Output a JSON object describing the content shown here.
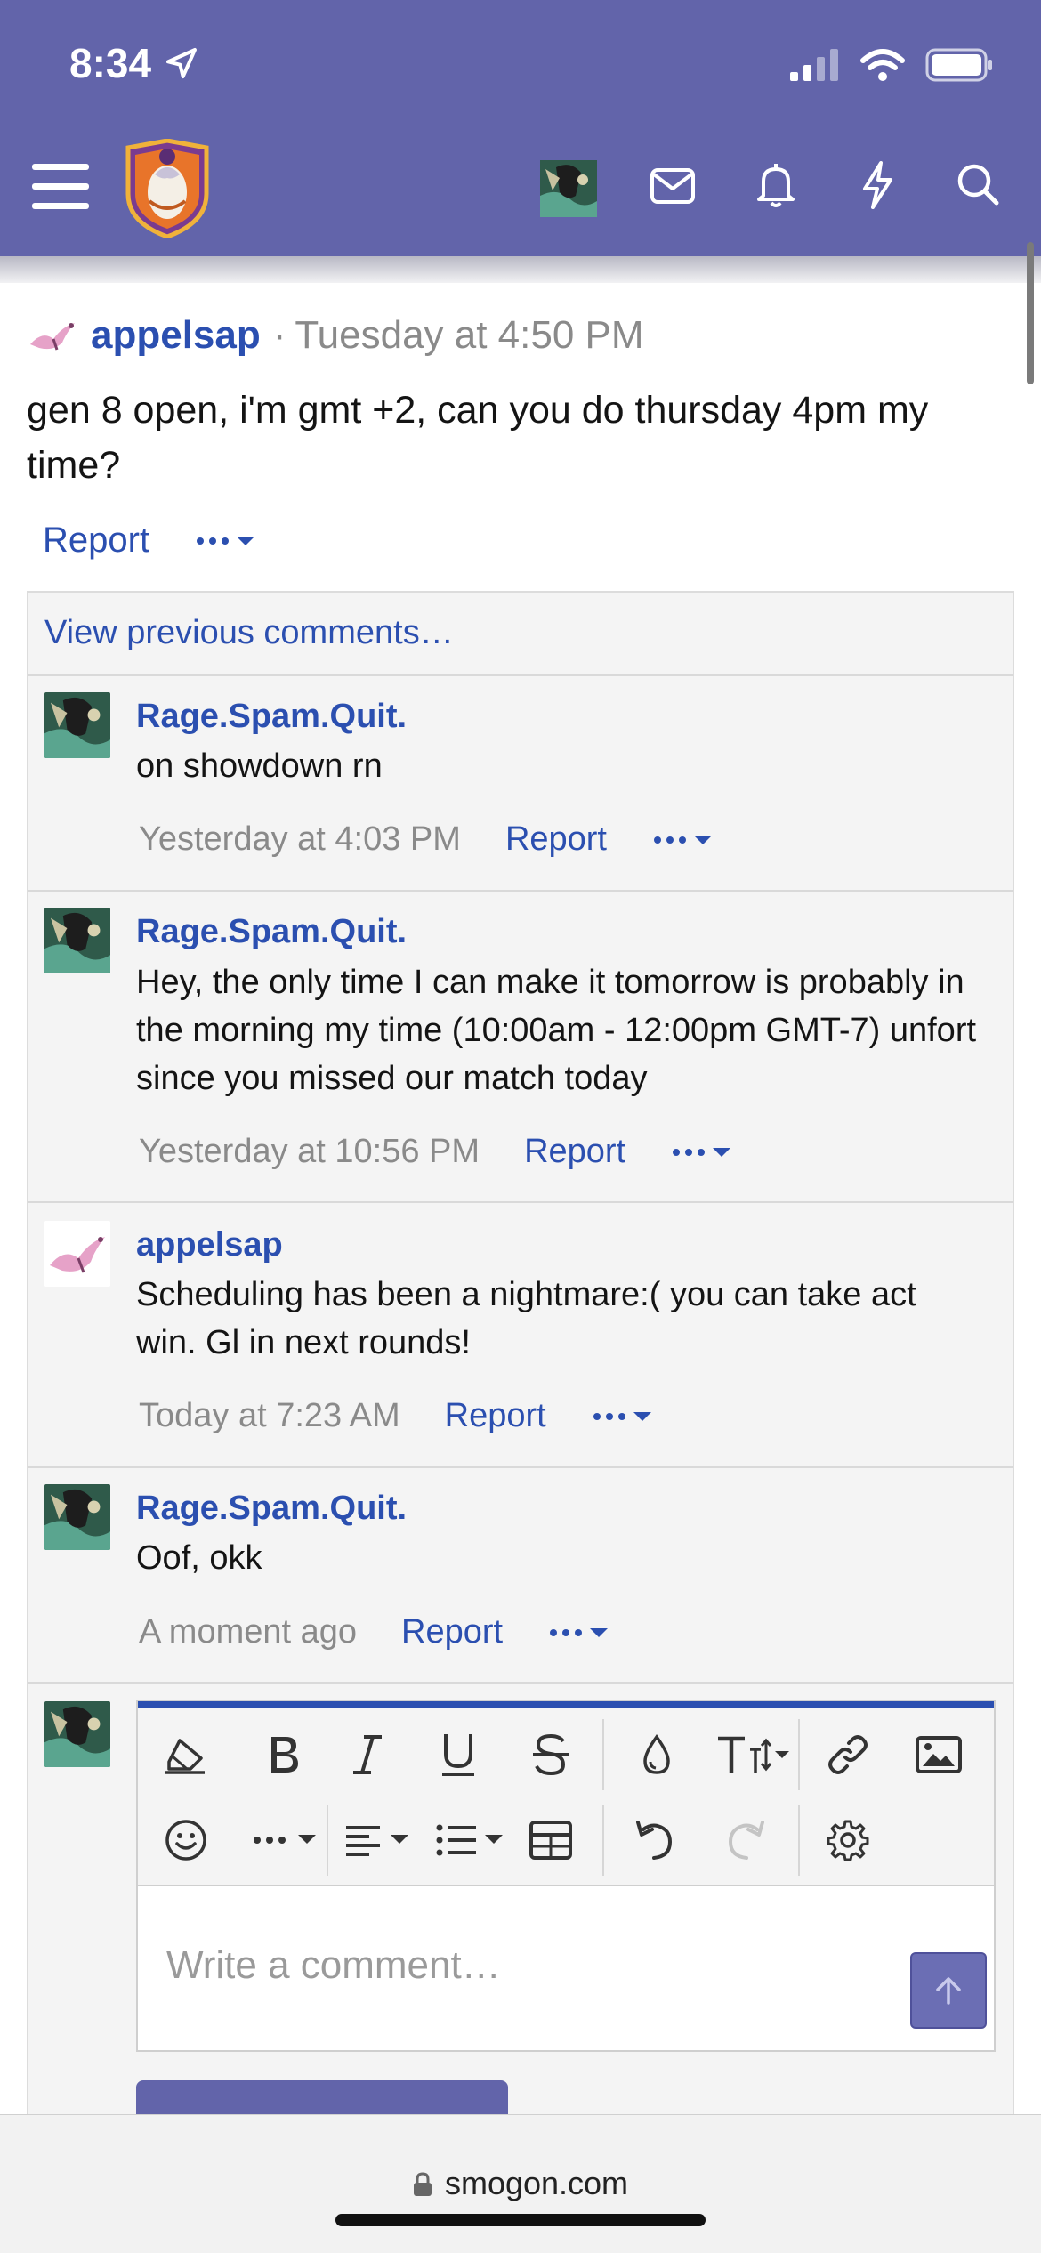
{
  "status_bar": {
    "time": "8:34"
  },
  "post": {
    "username": "appelsap",
    "separator": "·",
    "time": "Tuesday at 4:50 PM",
    "body": "gen 8 open, i'm gmt +2, can you do thursday 4pm my time?",
    "report": "Report"
  },
  "comments_section": {
    "view_previous": "View previous comments…",
    "report_label": "Report",
    "items": [
      {
        "user": "Rage.Spam.Quit.",
        "text": "on showdown rn",
        "time": "Yesterday at 4:03 PM"
      },
      {
        "user": "Rage.Spam.Quit.",
        "text": "Hey, the only time I can make it tomorrow is probably in the morning my time (10:00am - 12:00pm GMT-7) unfort since you missed our match today",
        "time": "Yesterday at 10:56 PM"
      },
      {
        "user": "appelsap",
        "text": "Scheduling has been a nightmare:( you can take act win. Gl in next rounds!",
        "time": "Today at 7:23 AM"
      },
      {
        "user": "Rage.Spam.Quit.",
        "text": "Oof, okk",
        "time": "A moment ago"
      }
    ]
  },
  "editor": {
    "placeholder": "Write a comment…"
  },
  "browser": {
    "url": "smogon.com"
  },
  "colors": {
    "header": "#6264aa",
    "link": "#2b4fb0",
    "meta": "#8a8a8a"
  }
}
